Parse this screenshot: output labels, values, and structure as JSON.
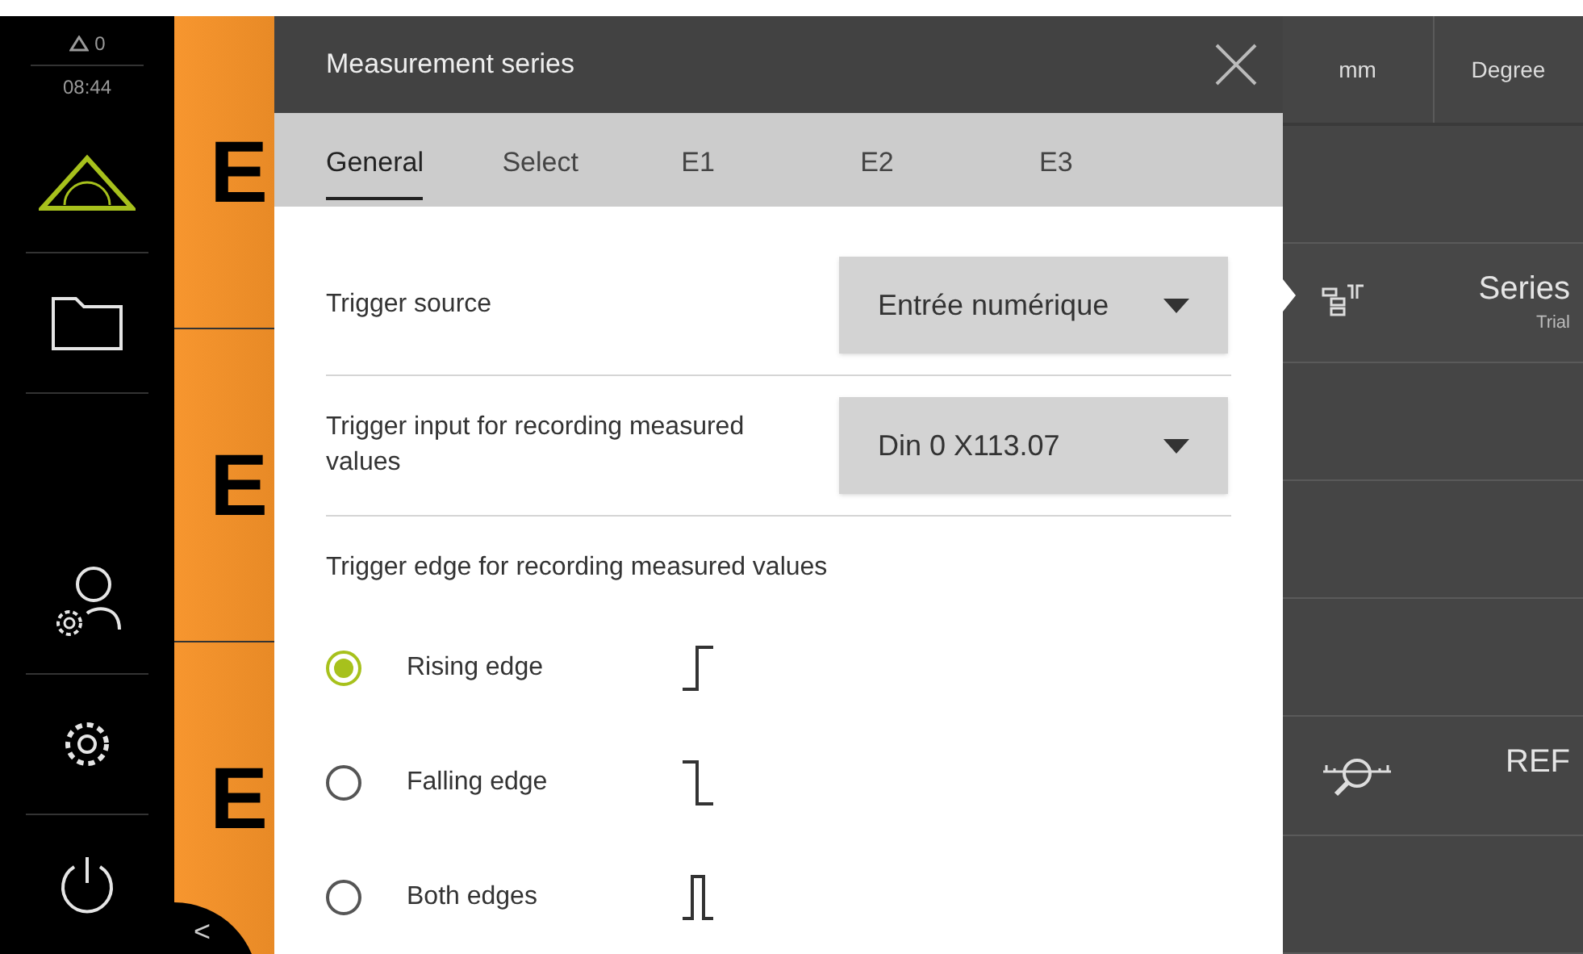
{
  "status": {
    "warnings": "0",
    "time": "08:44"
  },
  "sidebar": {
    "items": [
      {
        "kind": "measure",
        "selected": true
      },
      {
        "kind": "folder",
        "selected": false
      },
      {
        "kind": "user",
        "selected": false
      },
      {
        "kind": "settings",
        "selected": false
      },
      {
        "kind": "power",
        "selected": false
      }
    ]
  },
  "features": [
    {
      "label": "E"
    },
    {
      "label": "E"
    },
    {
      "label": "E"
    }
  ],
  "collapse_button": "<",
  "dialog": {
    "title": "Measurement series",
    "tabs": [
      {
        "label": "General",
        "selected": true
      },
      {
        "label": "Select",
        "selected": false
      },
      {
        "label": "E1",
        "selected": false
      },
      {
        "label": "E2",
        "selected": false
      },
      {
        "label": "E3",
        "selected": false
      }
    ],
    "fields": [
      {
        "label": "Trigger source",
        "value": "Entrée numérique"
      },
      {
        "label": "Trigger input for recording measured values",
        "value": "Din 0 X113.07"
      }
    ],
    "edge_group": {
      "label": "Trigger edge for recording measured values",
      "options": [
        {
          "label": "Rising edge",
          "kind": "rising",
          "selected": true
        },
        {
          "label": "Falling edge",
          "kind": "falling",
          "selected": false
        },
        {
          "label": "Both edges",
          "kind": "both",
          "selected": false
        }
      ]
    }
  },
  "units": [
    {
      "label": "mm"
    },
    {
      "label": "Degree"
    }
  ],
  "toolbar": [
    {
      "kind": "blank"
    },
    {
      "kind": "series",
      "title": "Series",
      "subtitle": "Trial",
      "selected": true
    },
    {
      "kind": "blank"
    },
    {
      "kind": "blank"
    },
    {
      "kind": "blank"
    },
    {
      "kind": "ref",
      "title": "REF"
    },
    {
      "kind": "blank"
    }
  ]
}
